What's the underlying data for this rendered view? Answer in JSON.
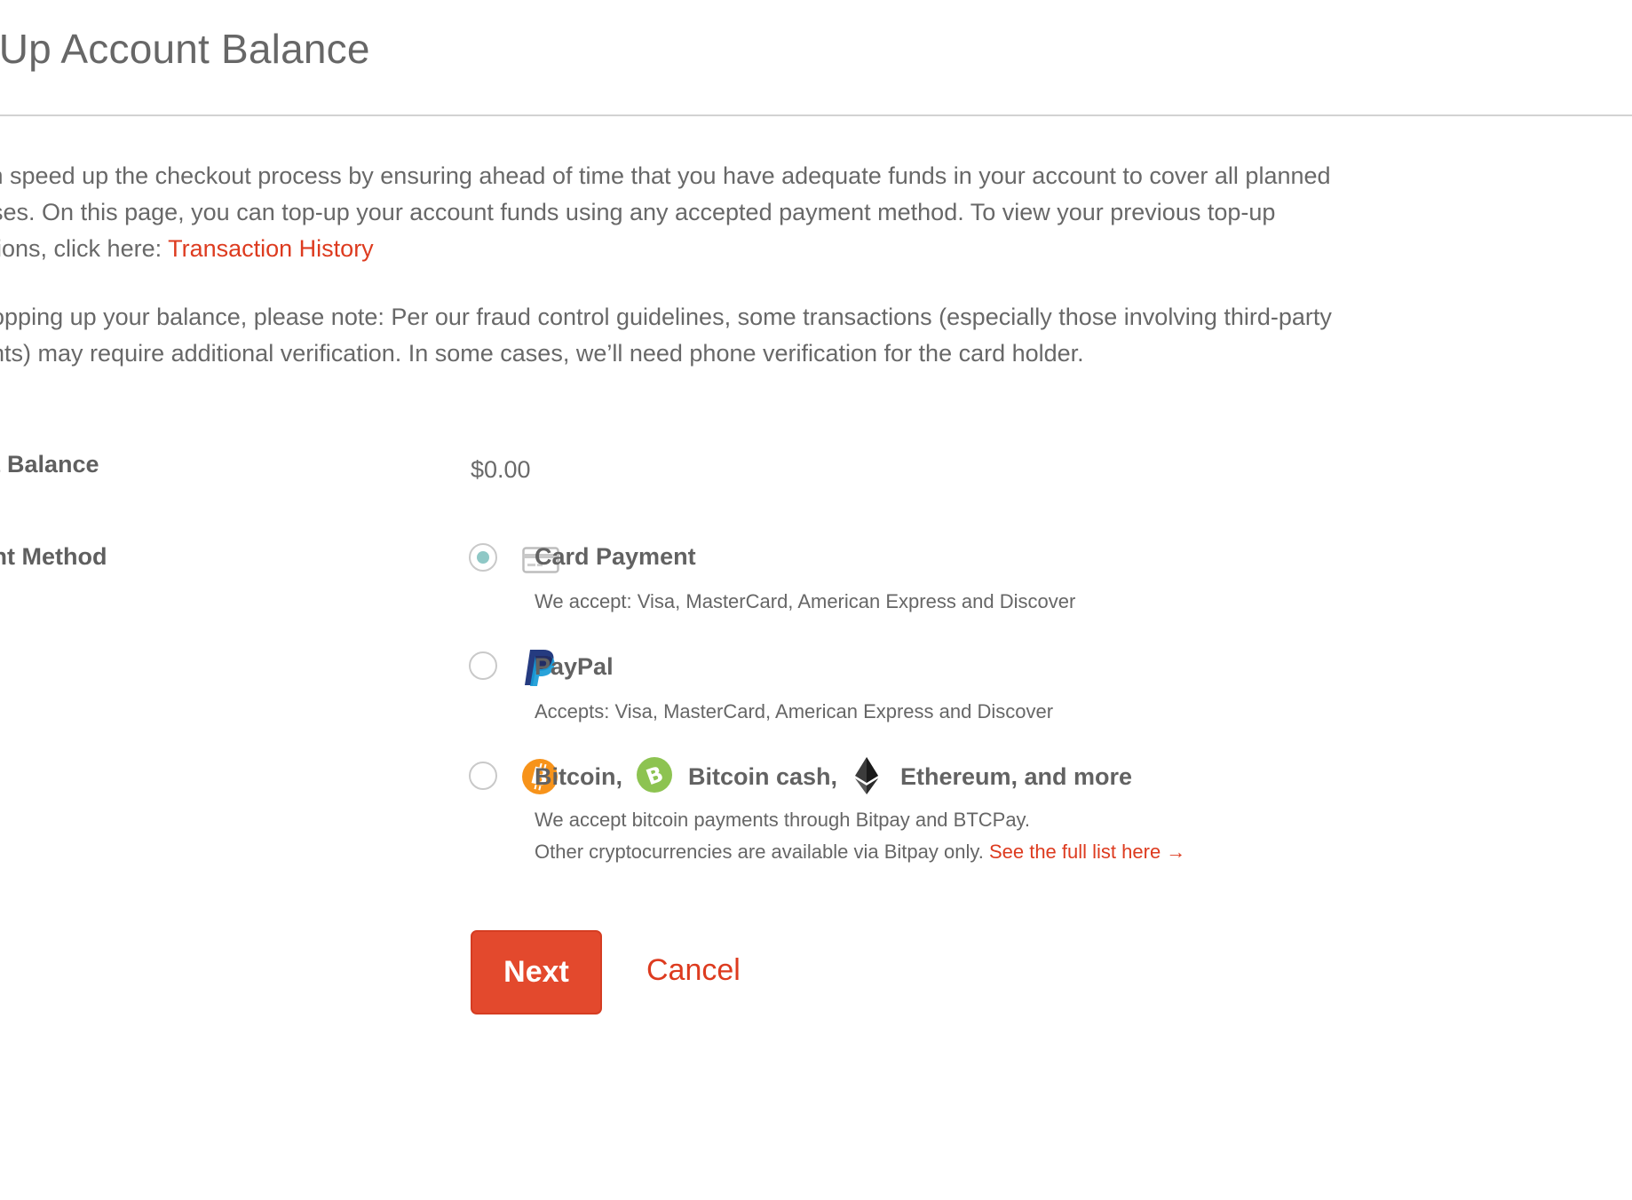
{
  "page": {
    "title": "p Up Account Balance",
    "intro_lines": [
      "can speed up the checkout process by ensuring ahead of time that you have adequate funds in your account to cover all planned",
      "hases. On this page, you can top-up your account funds using any accepted payment method. To view your previous top-up",
      "actions, click here: "
    ],
    "transaction_history_link": "Transaction History",
    "note_lines": [
      "n topping up your balance, please note: Per our fraud control guidelines, some transactions (especially those involving third-party",
      "nents) may require additional verification. In some cases, we’ll need phone verification for the card holder."
    ]
  },
  "balance": {
    "label": "ent Balance",
    "value": "$0.00"
  },
  "payment_method": {
    "label": "nent Method",
    "selected": "card",
    "options": {
      "card": {
        "title": "Card Payment",
        "desc": "We accept: Visa, MasterCard, American Express and Discover",
        "icon": "credit-card-icon"
      },
      "paypal": {
        "title": "PayPal",
        "desc": "Accepts: Visa, MasterCard, American Express and Discover",
        "icon": "paypal-icon"
      },
      "crypto": {
        "bitcoin": "Bitcoin,",
        "bitcoin_cash": "Bitcoin cash,",
        "ethereum": "Ethereum, and more",
        "desc_line1": "We accept bitcoin payments through Bitpay and BTCPay.",
        "desc_line2": "Other cryptocurrencies are available via Bitpay only. ",
        "full_list_link": "See the full list here →",
        "icons": [
          "bitcoin-icon",
          "bitcoin-cash-icon",
          "ethereum-icon"
        ]
      }
    }
  },
  "actions": {
    "next": "Next",
    "cancel": "Cancel"
  },
  "colors": {
    "accent": "#dd3b1f",
    "button": "#e3492d",
    "radio_selected": "#8fc8c6",
    "bitcoin": "#f7931a",
    "bitcoin_cash": "#8dc351",
    "paypal_dark": "#253b80",
    "paypal_light": "#179bd7"
  }
}
